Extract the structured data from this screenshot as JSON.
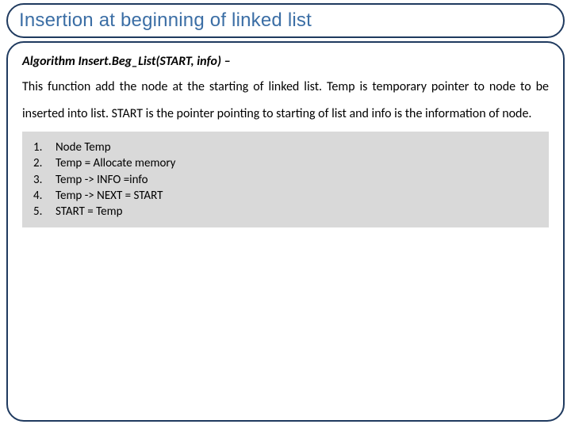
{
  "title": "Insertion at beginning of linked list",
  "algo": {
    "header": "Algorithm Insert.Beg_List(START, info) –",
    "description": "This function add the node at the starting of linked list. Temp is temporary pointer to node to be inserted into list. START is the pointer pointing to starting of list and info is the information of node."
  },
  "steps": [
    {
      "n": "1.",
      "text": "Node Temp"
    },
    {
      "n": "2.",
      "text": "Temp = Allocate memory"
    },
    {
      "n": "3.",
      "text": "Temp -> INFO =info"
    },
    {
      "n": "4.",
      "text": "Temp -> NEXT = START"
    },
    {
      "n": "5.",
      "text": " START = Temp"
    }
  ]
}
